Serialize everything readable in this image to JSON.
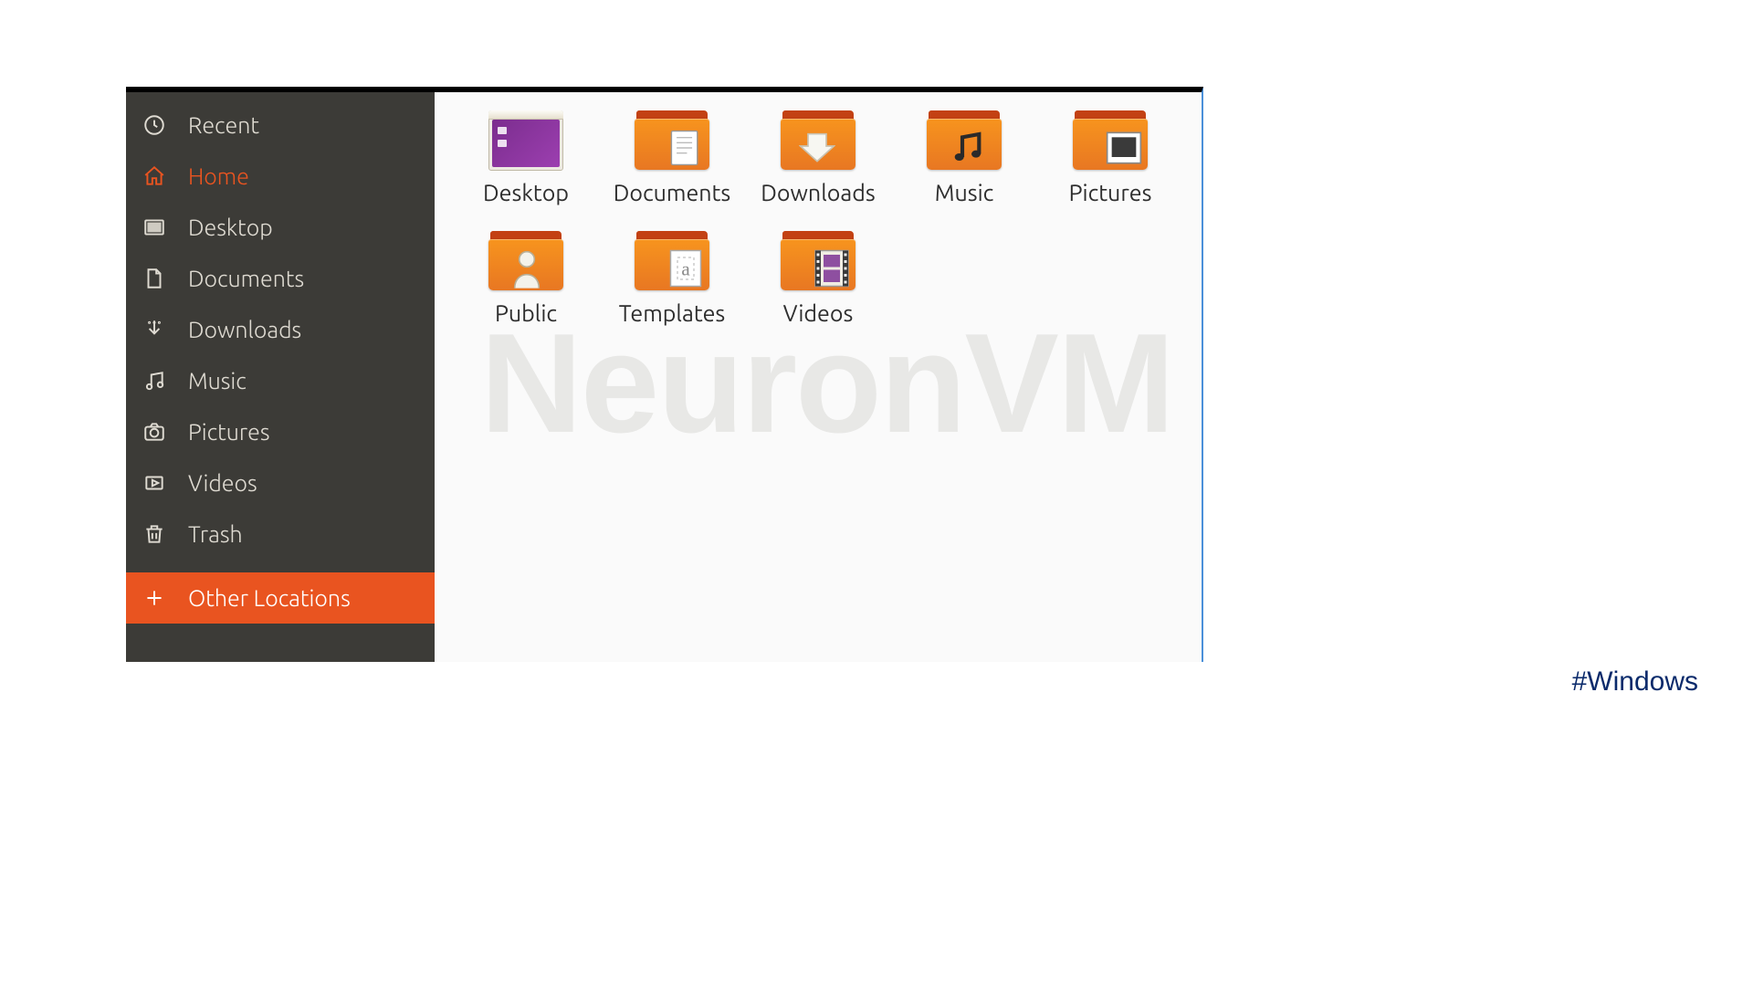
{
  "sidebar": {
    "items": [
      {
        "label": "Recent",
        "icon": "clock-icon"
      },
      {
        "label": "Home",
        "icon": "home-icon",
        "state": "active"
      },
      {
        "label": "Desktop",
        "icon": "desktop-folder-icon"
      },
      {
        "label": "Documents",
        "icon": "document-icon"
      },
      {
        "label": "Downloads",
        "icon": "download-icon"
      },
      {
        "label": "Music",
        "icon": "music-icon"
      },
      {
        "label": "Pictures",
        "icon": "camera-icon"
      },
      {
        "label": "Videos",
        "icon": "video-icon"
      },
      {
        "label": "Trash",
        "icon": "trash-icon"
      },
      {
        "label": "Other Locations",
        "icon": "plus-icon",
        "state": "highlighted"
      }
    ]
  },
  "main": {
    "folders": [
      {
        "name": "Desktop",
        "type": "desktop"
      },
      {
        "name": "Documents",
        "emblem": "document-emblem"
      },
      {
        "name": "Downloads",
        "emblem": "download-emblem"
      },
      {
        "name": "Music",
        "emblem": "music-emblem"
      },
      {
        "name": "Pictures",
        "emblem": "pictures-emblem"
      },
      {
        "name": "Public",
        "emblem": "public-emblem"
      },
      {
        "name": "Templates",
        "emblem": "templates-emblem"
      },
      {
        "name": "Videos",
        "emblem": "videos-emblem"
      }
    ]
  },
  "watermark": "NeuronVM",
  "footer_tag": "#Windows"
}
